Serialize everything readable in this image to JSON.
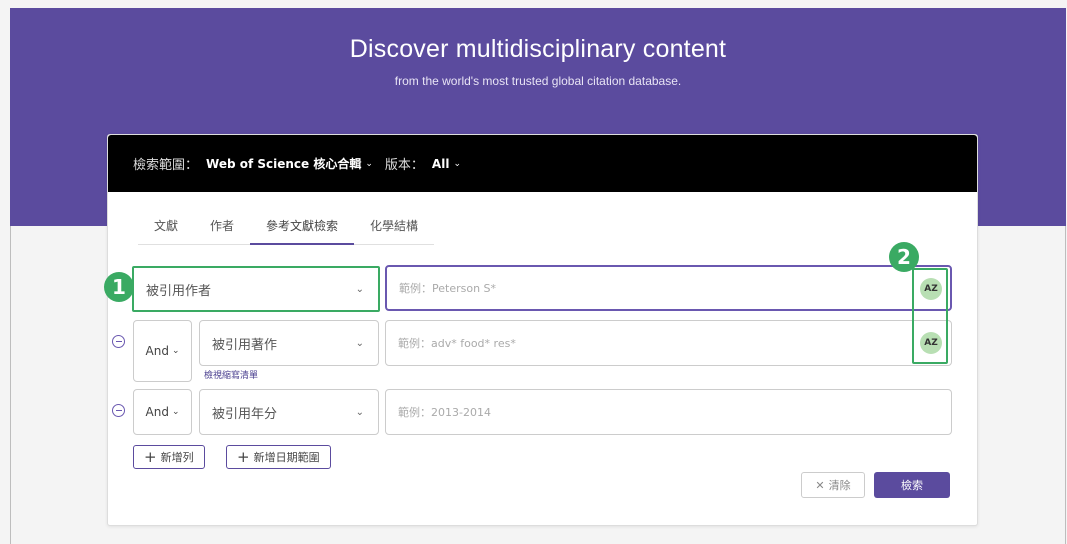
{
  "banner": {
    "title": "Discover multidisciplinary content",
    "subtitle": "from the world's most trusted global citation database."
  },
  "scope_bar": {
    "scope_label": "檢索範圍：",
    "scope_value": "Web of Science 核心合輯",
    "edition_label": "版本：",
    "edition_value": "All"
  },
  "tabs": [
    {
      "label": "文獻"
    },
    {
      "label": "作者"
    },
    {
      "label": "參考文獻檢索",
      "active": true
    },
    {
      "label": "化學結構"
    }
  ],
  "rows": [
    {
      "field": "被引用作者",
      "placeholder": "範例：Peterson S*",
      "az": "AZ"
    },
    {
      "bool": "And",
      "field": "被引用著作",
      "placeholder": "範例：adv* food* res*",
      "az": "AZ",
      "link": "檢視縮寫清單"
    },
    {
      "bool": "And",
      "field": "被引用年分",
      "placeholder": "範例：2013-2014"
    }
  ],
  "actions": {
    "add_row": "新增列",
    "add_date_range": "新增日期範圍",
    "clear": "清除",
    "search": "檢索"
  },
  "annotations": {
    "badge_1": "1",
    "badge_2": "2",
    "color": "#3aaa63"
  },
  "colors": {
    "brand_purple": "#5b4b9e",
    "scope_bar_bg": "#000000",
    "az_button_bg": "#b8dfb3"
  }
}
